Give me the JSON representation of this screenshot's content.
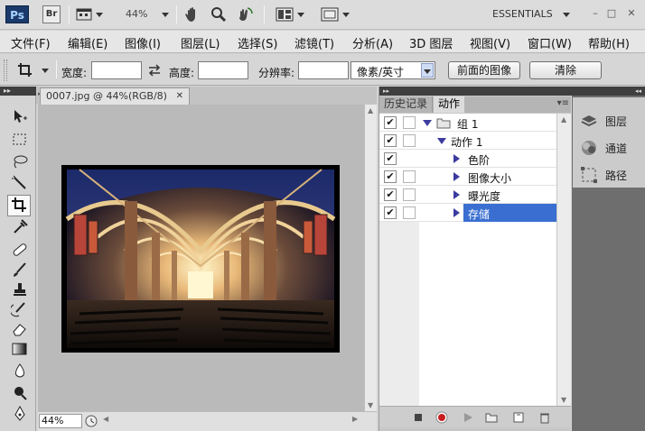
{
  "titlebar": {
    "ps_logo": "Ps",
    "br_logo": "Br",
    "zoom": "44%",
    "workspace": "ESSENTIALS",
    "window_controls": [
      "–",
      "□",
      "✕"
    ]
  },
  "menu": [
    "文件(F)",
    "编辑(E)",
    "图像(I)",
    "图层(L)",
    "选择(S)",
    "滤镜(T)",
    "分析(A)",
    "3D 图层",
    "视图(V)",
    "窗口(W)",
    "帮助(H)"
  ],
  "options": {
    "width_label": "宽度:",
    "height_label": "高度:",
    "resolution_label": "分辨率:",
    "unit_select": "像素/英寸",
    "front_image_button": "前面的图像",
    "clear_button": "清除",
    "width_value": "",
    "height_value": "",
    "resolution_value": ""
  },
  "document": {
    "tab_title": "0007.jpg @ 44%(RGB/8)",
    "close": "✕",
    "status_zoom": "44%"
  },
  "panel": {
    "tab_history": "历史记录",
    "tab_actions": "动作",
    "rows": [
      {
        "label": "组 1",
        "checked": true
      },
      {
        "label": "动作 1",
        "checked": true
      },
      {
        "label": "色阶",
        "checked": true
      },
      {
        "label": "图像大小",
        "checked": true
      },
      {
        "label": "曝光度",
        "checked": true
      },
      {
        "label": "存储",
        "checked": true,
        "selected": true
      }
    ]
  },
  "dock": {
    "layers": "图层",
    "channels": "通道",
    "paths": "路径"
  },
  "colors": {
    "selection": "#3a6fd1",
    "panel_bg": "#c7c7c7",
    "dock_bg": "#6e6e6e"
  }
}
